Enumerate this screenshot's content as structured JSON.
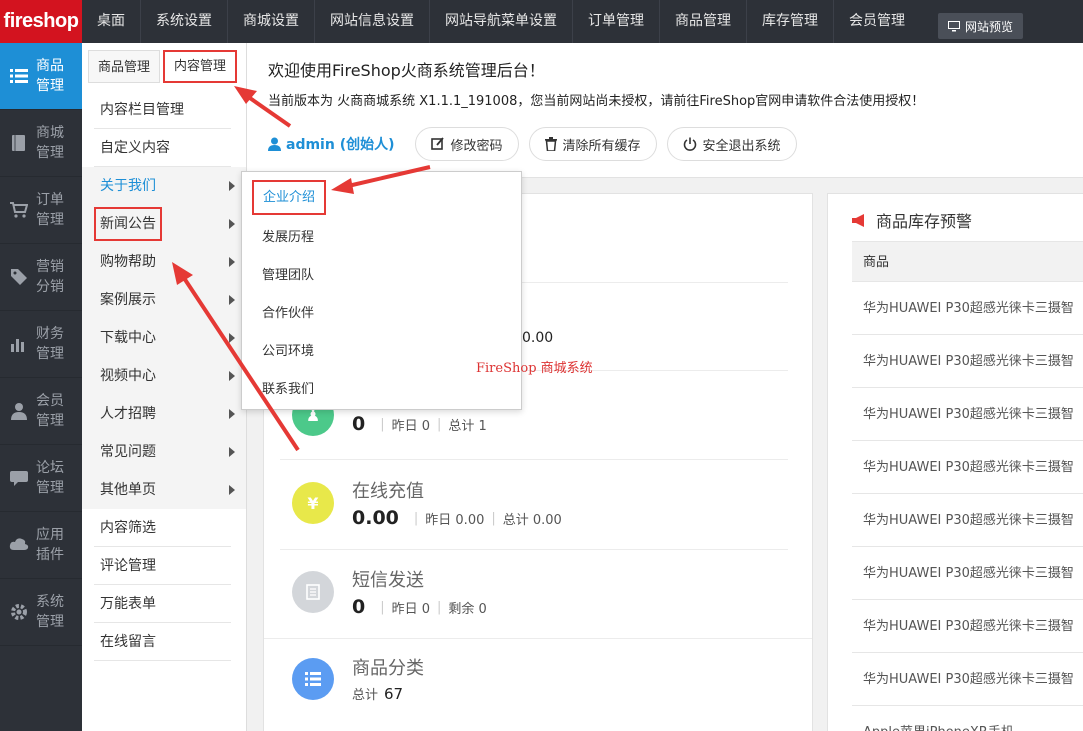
{
  "logo": "fireshop",
  "topnav": [
    "桌面",
    "系统设置",
    "商城设置",
    "网站信息设置",
    "网站导航菜单设置",
    "订单管理",
    "商品管理",
    "库存管理",
    "会员管理"
  ],
  "preview_label": "网站预览",
  "iconbar": [
    {
      "label": "商品管理",
      "icon": "list-icon"
    },
    {
      "label": "商城管理",
      "icon": "book-icon"
    },
    {
      "label": "订单管理",
      "icon": "cart-icon"
    },
    {
      "label": "营销分销",
      "icon": "tag-icon"
    },
    {
      "label": "财务管理",
      "icon": "bar-chart-icon"
    },
    {
      "label": "会员管理",
      "icon": "user-icon"
    },
    {
      "label": "论坛管理",
      "icon": "chat-icon"
    },
    {
      "label": "应用插件",
      "icon": "cloud-icon"
    },
    {
      "label": "系统管理",
      "icon": "gear-icon"
    }
  ],
  "subtabs": [
    "商品管理",
    "内容管理"
  ],
  "menu_top": [
    "内容栏目管理",
    "自定义内容"
  ],
  "menu_groups": [
    "关于我们",
    "新闻公告",
    "购物帮助",
    "案例展示",
    "下载中心",
    "视频中心",
    "人才招聘",
    "常见问题",
    "其他单页"
  ],
  "menu_bottom": [
    "内容筛选",
    "评论管理",
    "万能表单",
    "在线留言"
  ],
  "header": {
    "welcome": "欢迎使用FireShop火商系统管理后台！",
    "version": "当前版本为 火商商城系统 X1.1.1_191008，您当前网站尚未授权，请前往FireShop官网申请软件合法使用授权！",
    "admin": "admin (创始人)",
    "buttons": [
      "修改密码",
      "清除所有缓存",
      "安全退出系统"
    ]
  },
  "flyout": [
    "企业介绍",
    "发展历程",
    "管理团队",
    "合作伙伴",
    "公司环境",
    "联系我们"
  ],
  "watermark": "FireShop 商城系统",
  "stats": {
    "partial_value": "0.00",
    "s1": {
      "big": "0",
      "yesterday": "昨日 0",
      "total": "总计 1"
    },
    "recharge": {
      "name": "在线充值",
      "big": "0.00",
      "yesterday": "昨日 0.00",
      "total": "总计 0.00"
    },
    "sms": {
      "name": "短信发送",
      "big": "0",
      "yesterday": "昨日 0",
      "remain": "剩余 0"
    },
    "category": {
      "name": "商品分类",
      "total_label": "总计",
      "total_value": "67"
    }
  },
  "stock": {
    "title": "商品库存预警",
    "col": "商品",
    "rows": [
      "华为HUAWEI P30超感光徕卡三摄智",
      "华为HUAWEI P30超感光徕卡三摄智",
      "华为HUAWEI P30超感光徕卡三摄智",
      "华为HUAWEI P30超感光徕卡三摄智",
      "华为HUAWEI P30超感光徕卡三摄智",
      "华为HUAWEI P30超感光徕卡三摄智",
      "华为HUAWEI P30超感光徕卡三摄智",
      "华为HUAWEI P30超感光徕卡三摄智"
    ],
    "last_row": "Apple苹果iPhoneXR手机"
  },
  "colors": {
    "accent": "#1e8fd6",
    "brand": "#d3131f",
    "highlight": "#e53935"
  }
}
